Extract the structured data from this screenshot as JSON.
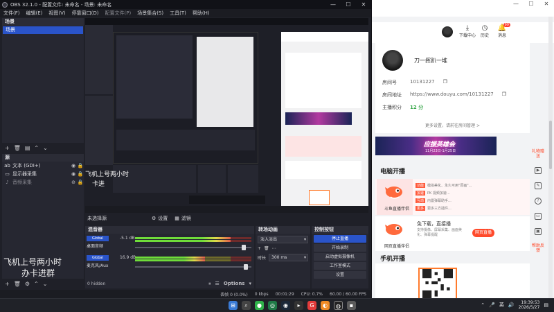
{
  "obs": {
    "title": "OBS 32.1.0 - 配置文件: 未命名 - 场景: 未命名",
    "menu": [
      "文件(F)",
      "编辑(E)",
      "视图(V)",
      "停靠窗口(D)",
      "配置文件(P)",
      "场景集合(S)",
      "工具(T)",
      "帮助(H)"
    ],
    "scenes": {
      "header": "场景",
      "items": [
        "场景"
      ]
    },
    "sources": {
      "header": "源",
      "items": [
        {
          "icon": "text-icon",
          "label": "文本 (GDI+)",
          "dim": false
        },
        {
          "icon": "display-icon",
          "label": "显示器采集",
          "dim": false
        },
        {
          "icon": "music-icon",
          "label": "音频采集",
          "dim": true
        }
      ],
      "overlay_text_1": "飞机上号两小时",
      "overlay_text_2": "办卡进群"
    },
    "preview_overlay": "飞机上号两小时",
    "preview_bottom_overlay": "卡进",
    "scene_control": {
      "name": "未选择源",
      "settings": "设置",
      "filters": "滤镜"
    },
    "mixer": {
      "header": "混音器",
      "channels": [
        {
          "badge": "Global",
          "db": "-5.1 dB",
          "name": "桌面音频",
          "level": 0.82,
          "fader": 0.95
        },
        {
          "badge": "Global",
          "db": "16.9 dB",
          "name": "麦克风/Aux",
          "level": 0.6,
          "fader": 0.97
        }
      ],
      "footer": "0 hidden",
      "options": "Options"
    },
    "transitions": {
      "header": "转场动画",
      "selected": "淡入淡出",
      "duration_label": "时长",
      "duration": "300 ms"
    },
    "controls": {
      "header": "控制按钮",
      "buttons": [
        "停止直播",
        "开始录制",
        "启动虚拟摄像机",
        "工作室模式",
        "设置"
      ]
    },
    "status": {
      "frames": "丢帧 0 (0.0%)",
      "bitrate": "0 kbps",
      "time": "00:01:29",
      "cpu": "CPU: 0.7%",
      "fps": "60.00 / 60.00 FPS"
    }
  },
  "browser": {
    "header": {
      "download": "下载中心",
      "history": "历史",
      "notifications": "消息",
      "notif_count": "99"
    },
    "profile": {
      "username": "刀一挥趴一堆",
      "room_label": "房间号",
      "room_id": "10131227",
      "addr_label": "房间地址",
      "addr": "https://www.douyu.com/10131227",
      "points_label": "主播积分",
      "points": "12 分",
      "more": "更多设置，请前往房间管理 >"
    },
    "banner": {
      "title": "应援英雄会",
      "subtitle": "11月23日-1月25日"
    },
    "pc_section": "电脑开播",
    "desktop_app": {
      "name": "斗鱼直播伴侣",
      "features": [
        {
          "tag": "功能",
          "text": "模拟美化、永久可用\"原画\"..."
        },
        {
          "tag": "加速",
          "text": "PK 视频加速..."
        },
        {
          "tag": "互动",
          "text": "内置弹幕助手..."
        },
        {
          "tag": "更多",
          "text": "更多三方插件..."
        }
      ]
    },
    "web_app": {
      "name": "网页直播伴侣",
      "title": "免下载，直接播",
      "desc": "支持摄像、屏幕采集、画面美化、弹幕提醒",
      "open": "网页直播"
    },
    "mobile_section": "手机开播",
    "right_sidebar": {
      "promo": "礼物赠送",
      "help": "帮助反馈"
    }
  },
  "taskbar": {
    "tray_lang": "英",
    "time": "19:39:53",
    "date": "2026/5/27"
  },
  "colors": {
    "obs_accent": "#2a54c9",
    "douyu_orange": "#ff4a2b",
    "points_green": "#3aa84c"
  }
}
